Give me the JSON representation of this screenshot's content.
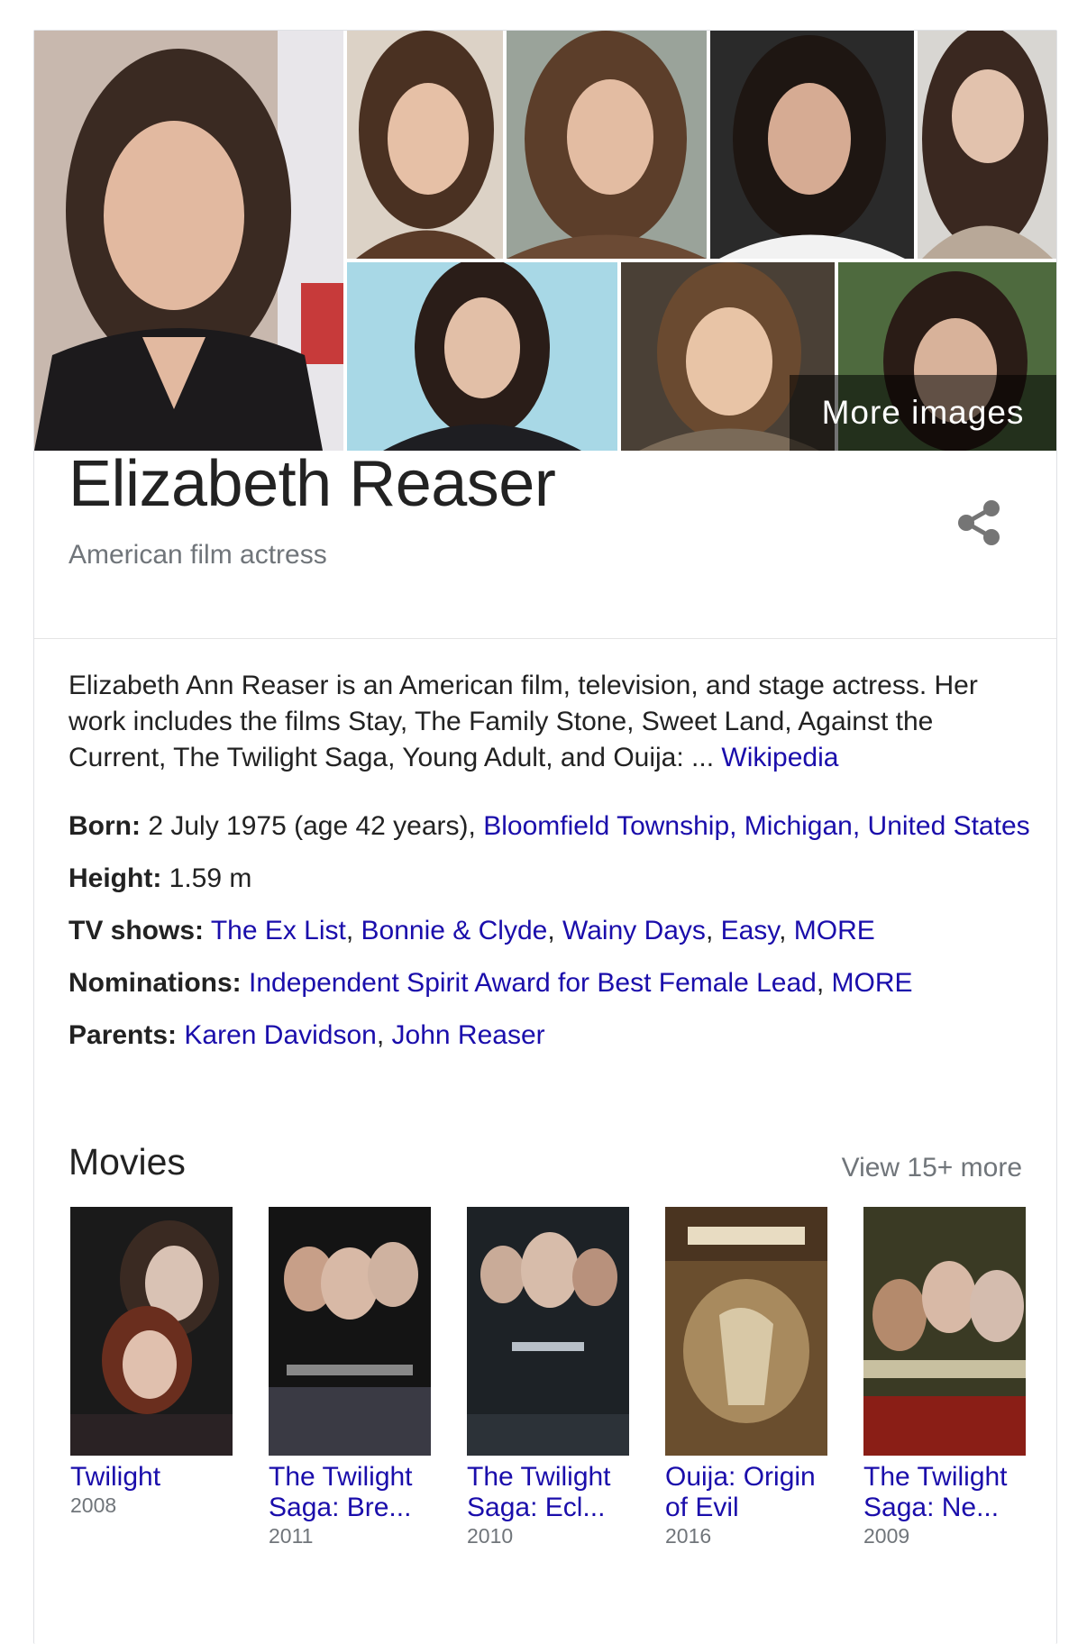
{
  "person": {
    "name": "Elizabeth Reaser",
    "subtitle": "American film actress",
    "more_images_label": "More images"
  },
  "description": {
    "text": "Elizabeth Ann Reaser is an American film, television, and stage actress. Her work includes the films Stay, The Family Stone, Sweet Land, Against the Current, The Twilight Saga, Young Adult, and Ouija: ... ",
    "source_link": "Wikipedia"
  },
  "facts": {
    "born": {
      "label": "Born:",
      "text": " 2 July 1975 (age 42 years), ",
      "place": "Bloomfield Township, Michigan, United States"
    },
    "height": {
      "label": "Height:",
      "value": " 1.59 m"
    },
    "tv_shows": {
      "label": "TV shows:",
      "items": [
        "The Ex List",
        "Bonnie & Clyde",
        "Wainy Days",
        "Easy"
      ],
      "more": "MORE"
    },
    "nominations": {
      "label": "Nominations:",
      "items": [
        "Independent Spirit Award for Best Female Lead"
      ],
      "more": "MORE"
    },
    "parents": {
      "label": "Parents:",
      "items": [
        "Karen Davidson",
        "John Reaser"
      ]
    }
  },
  "movies": {
    "heading": "Movies",
    "view_more": "View 15+ more",
    "items": [
      {
        "title": "Twilight",
        "year": "2008"
      },
      {
        "title": "The Twilight Saga: Bre...",
        "year": "2011"
      },
      {
        "title": "The Twilight Saga: Ecl...",
        "year": "2010"
      },
      {
        "title": "Ouija: Origin of Evil",
        "year": "2016"
      },
      {
        "title": "The Twilight Saga: Ne...",
        "year": "2009"
      }
    ]
  },
  "colors": {
    "link": "#1a0dab",
    "secondary_text": "#70757a",
    "border": "#dfe1e5"
  },
  "icons": {
    "share": "share-icon"
  }
}
